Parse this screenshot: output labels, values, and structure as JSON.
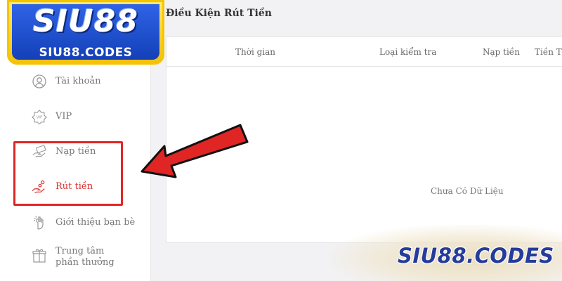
{
  "brand": {
    "logo_main": "SIU88",
    "logo_sub": "SIU88.CODES",
    "watermark": "SIU88.CODES",
    "colors": {
      "logo_blue": "#1f4fd0",
      "logo_gold": "#f6c400",
      "accent_red": "#e02525",
      "active_text": "#d9302c"
    }
  },
  "sidebar": {
    "items": [
      {
        "label": "Tài khoản",
        "icon": "user-circle-icon",
        "active": false
      },
      {
        "label": "VIP",
        "icon": "vip-badge-icon",
        "active": false
      },
      {
        "label": "Nạp tiền",
        "icon": "deposit-hand-icon",
        "active": false
      },
      {
        "label": "Rút tiền",
        "icon": "withdraw-hand-icon",
        "active": true
      },
      {
        "label": "Giới thiệu bạn bè",
        "icon": "invite-hand-icon",
        "active": false
      },
      {
        "label": "Trung tâm phần thưởng",
        "icon": "gift-icon",
        "active": false
      }
    ]
  },
  "main": {
    "title": "Điều Kiện Rút Tiền",
    "table": {
      "columns": [
        "Thời gian",
        "Loại kiểm tra",
        "Nạp tiền",
        "Tiền Thư"
      ],
      "empty_text": "Chưa Có Dữ Liệu"
    }
  }
}
